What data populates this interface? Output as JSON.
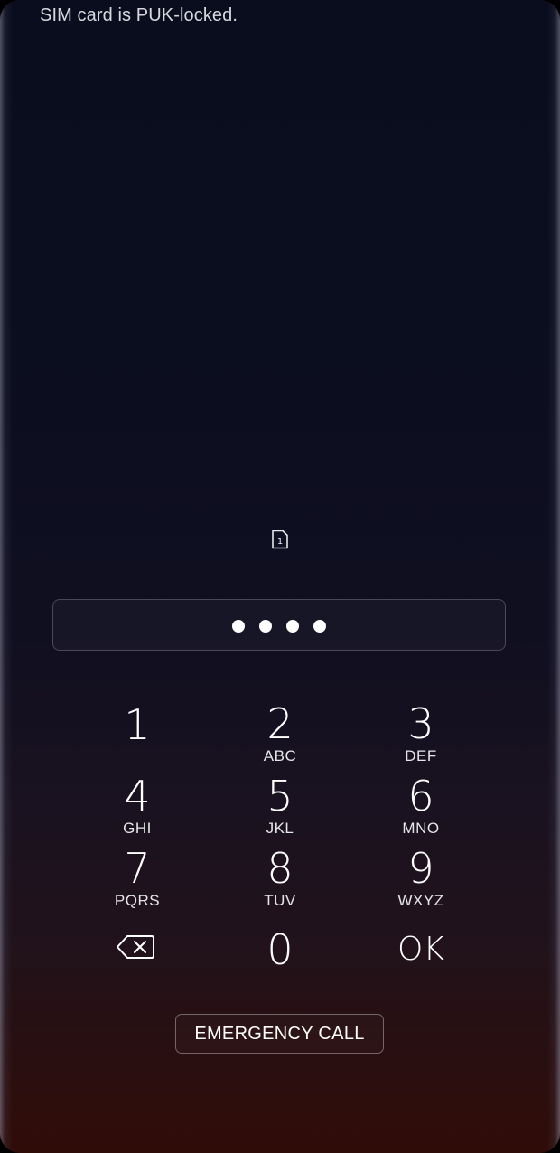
{
  "status": {
    "message": "SIM card is PUK-locked."
  },
  "sim_indicator": {
    "icon": "sim-card-icon",
    "slot": "1"
  },
  "pin_entry": {
    "entered_digits_count": 4,
    "mask_char": "●"
  },
  "keypad": {
    "keys": [
      {
        "digit": "1",
        "letters": ""
      },
      {
        "digit": "2",
        "letters": "ABC"
      },
      {
        "digit": "3",
        "letters": "DEF"
      },
      {
        "digit": "4",
        "letters": "GHI"
      },
      {
        "digit": "5",
        "letters": "JKL"
      },
      {
        "digit": "6",
        "letters": "MNO"
      },
      {
        "digit": "7",
        "letters": "PQRS"
      },
      {
        "digit": "8",
        "letters": "TUV"
      },
      {
        "digit": "9",
        "letters": "WXYZ"
      },
      {
        "digit": "0",
        "letters": ""
      }
    ],
    "backspace_icon": "backspace-icon",
    "ok_label": "OK"
  },
  "emergency_call": {
    "label": "EMERGENCY CALL"
  },
  "colors": {
    "background_top": "#0a0d1e",
    "background_bottom": "#300c08",
    "text": "#ffffff"
  }
}
